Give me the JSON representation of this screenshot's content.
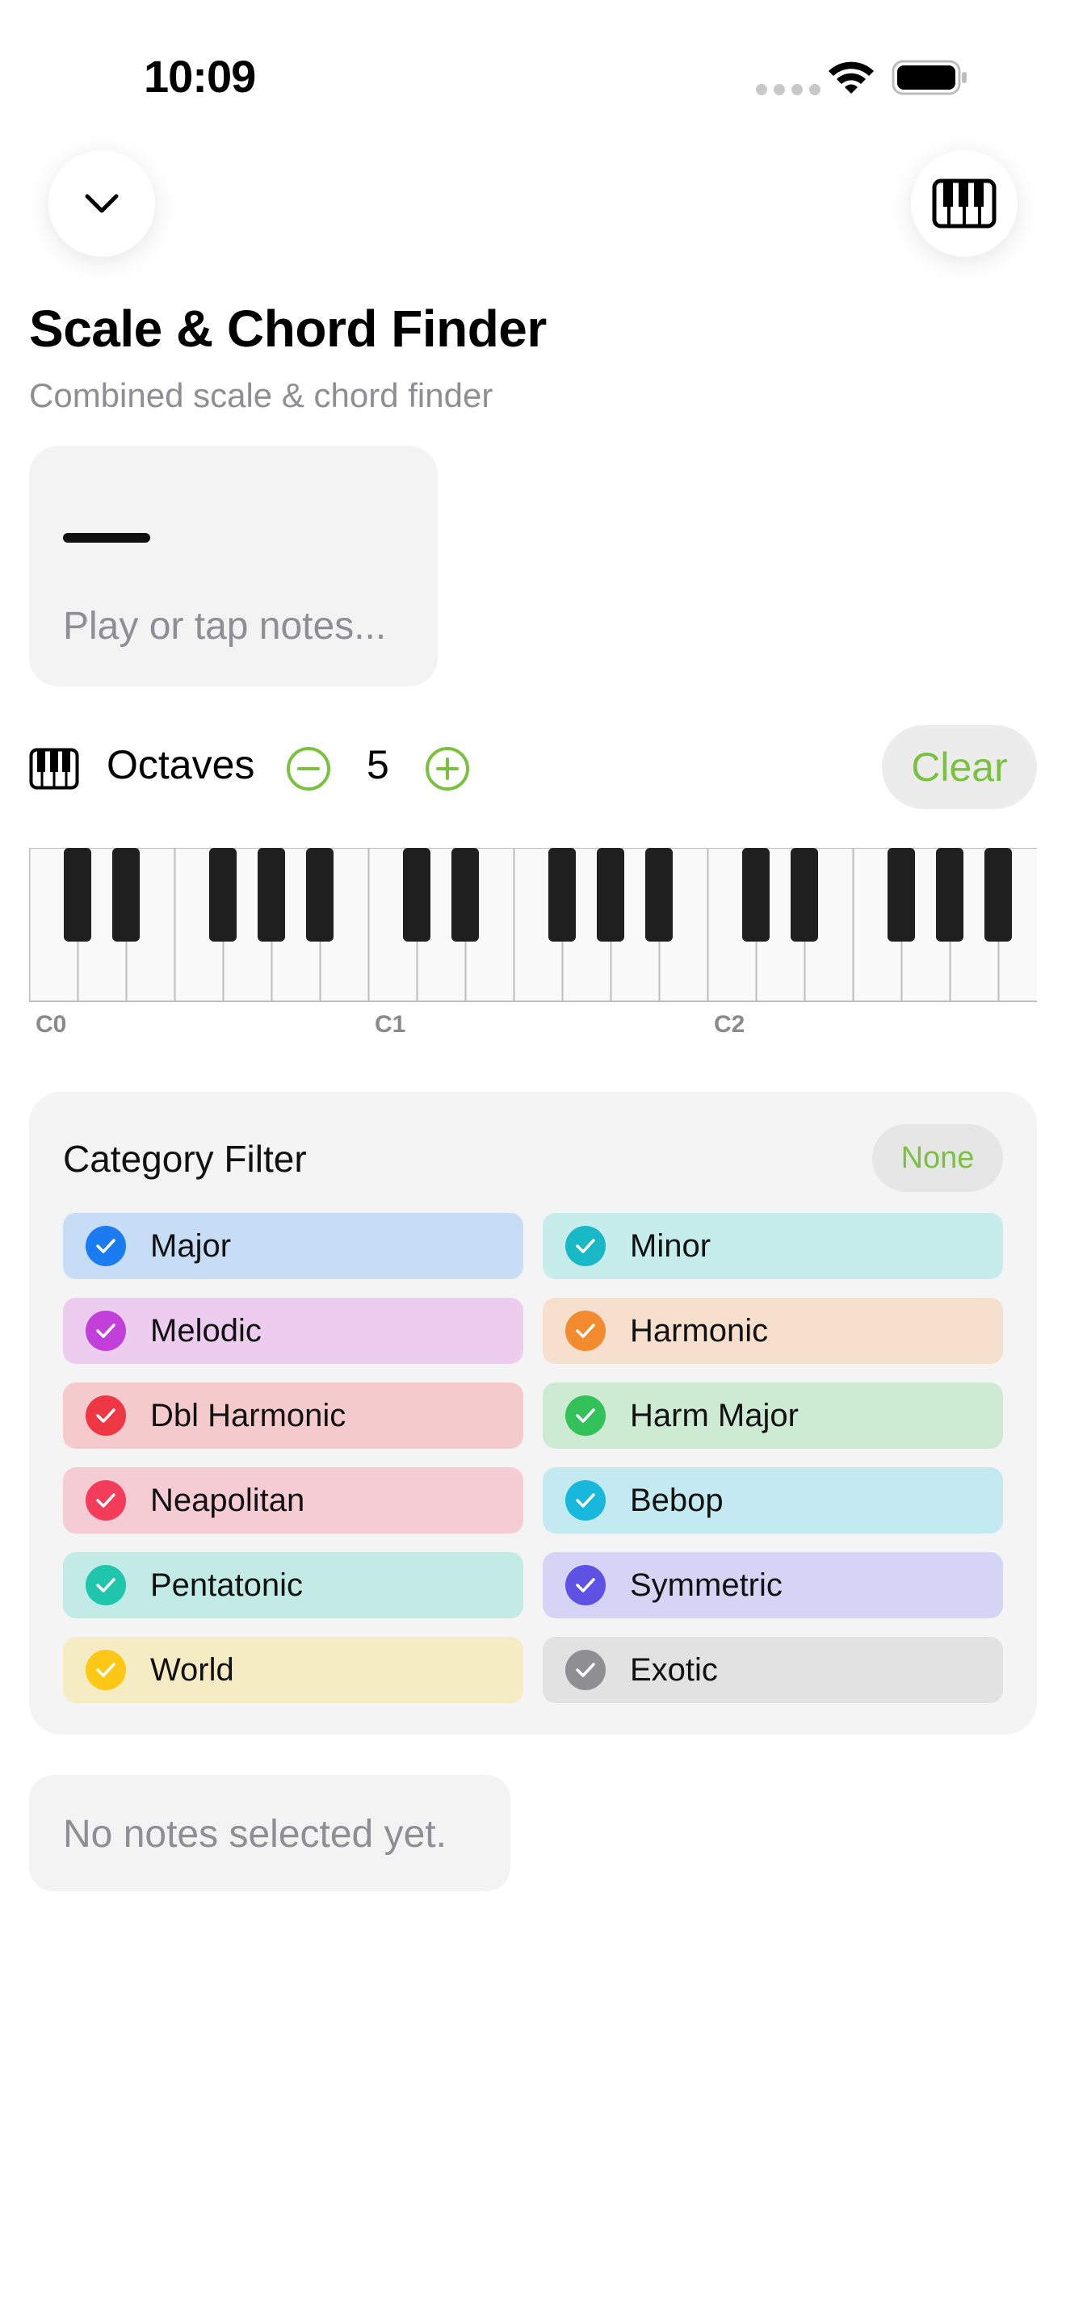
{
  "status_bar": {
    "time": "10:09"
  },
  "header": {
    "title": "Scale & Chord Finder",
    "subtitle": "Combined scale & chord finder"
  },
  "note_input": {
    "placeholder": "Play or tap notes..."
  },
  "octaves": {
    "label": "Octaves",
    "value": "5",
    "clear_label": "Clear"
  },
  "keyboard": {
    "labels": [
      "C0",
      "C1",
      "C2"
    ]
  },
  "filter": {
    "title": "Category Filter",
    "none_label": "None",
    "categories": [
      {
        "label": "Major",
        "bg": "#c7ddf6",
        "color": "#1a7cf0",
        "checked": true
      },
      {
        "label": "Minor",
        "bg": "#c6ecec",
        "color": "#18b8c6",
        "checked": true
      },
      {
        "label": "Melodic",
        "bg": "#eccdef",
        "color": "#c33fd9",
        "checked": true
      },
      {
        "label": "Harmonic",
        "bg": "#f7dfcd",
        "color": "#f28a2e",
        "checked": true
      },
      {
        "label": "Dbl Harmonic",
        "bg": "#f5cacc",
        "color": "#ee3742",
        "checked": true
      },
      {
        "label": "Harm Major",
        "bg": "#cdebd3",
        "color": "#33c15a",
        "checked": true
      },
      {
        "label": "Neapolitan",
        "bg": "#f5ccd3",
        "color": "#f23c5a",
        "checked": true
      },
      {
        "label": "Bebop",
        "bg": "#c3e9f1",
        "color": "#17b8dc",
        "checked": true
      },
      {
        "label": "Pentatonic",
        "bg": "#c3ebe6",
        "color": "#1fc6ac",
        "checked": true
      },
      {
        "label": "Symmetric",
        "bg": "#d5d4f5",
        "color": "#5d52e3",
        "checked": true
      },
      {
        "label": "World",
        "bg": "#f6ecc3",
        "color": "#fcc815",
        "checked": true
      },
      {
        "label": "Exotic",
        "bg": "#e2e2e2",
        "color": "#8e8e93",
        "checked": true
      }
    ]
  },
  "results": {
    "empty_text": "No notes selected yet."
  },
  "colors": {
    "accent": "#7ac23e"
  }
}
